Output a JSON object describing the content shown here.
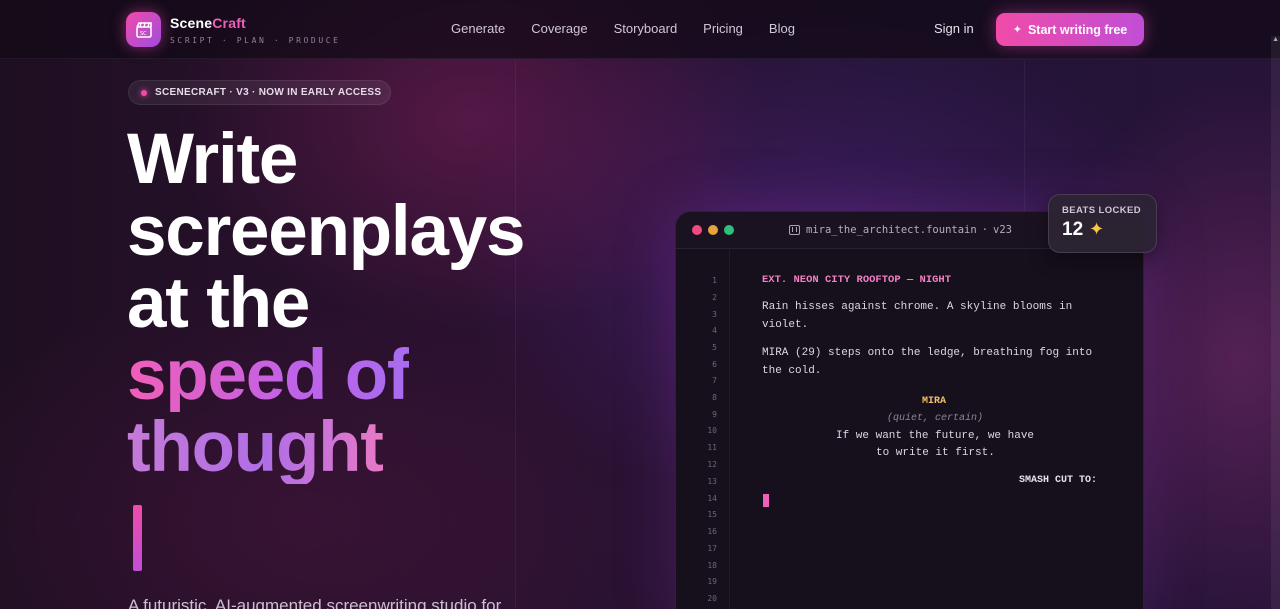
{
  "brand": {
    "name_part1": "Scene",
    "name_part2": "Craft",
    "tagline": "SCRIPT · PLAN · PRODUCE",
    "logo_icon": "clapperboard-icon"
  },
  "nav": {
    "links": [
      "Generate",
      "Coverage",
      "Storyboard",
      "Pricing",
      "Blog"
    ],
    "signin": "Sign in",
    "cta": "Start writing free",
    "cta_icon": "sparkle-icon"
  },
  "badge": {
    "text": "SCENECRAFT · V3 · NOW IN EARLY ACCESS"
  },
  "hero": {
    "line1": "Write",
    "line2": "screenplays",
    "line3": "at the",
    "line4": "speed of",
    "line5": "thought",
    "subtext": "A futuristic, AI-augmented screenwriting studio for"
  },
  "editor": {
    "filename": "mira_the_architect.fountain",
    "separator": "·",
    "version": "v23",
    "line_numbers": [
      "1",
      "2",
      "3",
      "4",
      "5",
      "6",
      "7",
      "8",
      "9",
      "10",
      "11",
      "12",
      "13",
      "14",
      "15",
      "16",
      "17",
      "18",
      "19",
      "20"
    ],
    "script": {
      "slugline": "EXT. NEON CITY ROOFTOP — NIGHT",
      "action1_l1": "Rain hisses against chrome. A skyline blooms in",
      "action1_l2": "violet.",
      "action2_l1": "MIRA (29) steps onto the ledge, breathing fog into",
      "action2_l2": "the cold.",
      "character": "MIRA",
      "parenthetical": "(quiet, certain)",
      "dialogue_l1": "If we want the future, we have",
      "dialogue_l2": "to write it first.",
      "transition": "SMASH CUT TO:"
    }
  },
  "beats": {
    "label": "BEATS LOCKED",
    "count": "12",
    "icon": "star-sparkle-icon"
  },
  "colors": {
    "accent_pink": "#f04ba8",
    "accent_purple": "#c14ed6",
    "slug": "#f17fc4",
    "character": "#f0c16b"
  }
}
